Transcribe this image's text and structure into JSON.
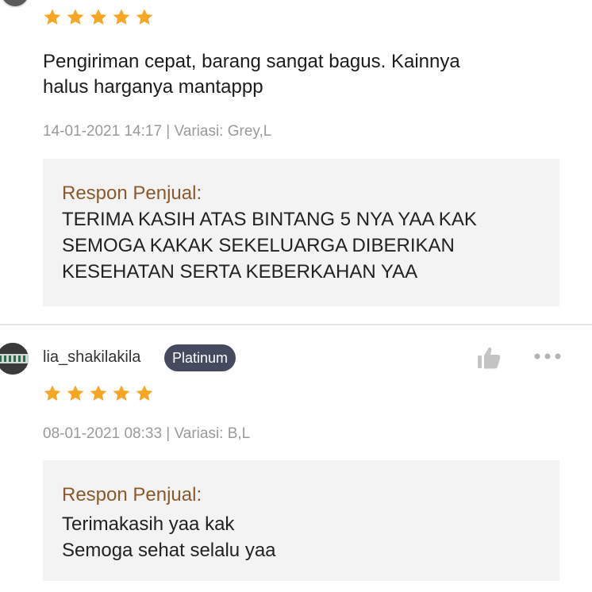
{
  "review1": {
    "rating": 5,
    "comment_line1": "Pengiriman cepat, barang sangat bagus. Kainnya",
    "comment_line2": "halus harganya mantappp",
    "meta": "14-01-2021 14:17 | Variasi: Grey,L",
    "reply": {
      "title": "Respon Penjual:",
      "lines": [
        "TERIMA KASIH ATAS BINTANG 5 NYA YAA KAK",
        "SEMOGA KAKAK SEKELUARGA DIBERIKAN",
        "KESEHATAN SERTA KEBERKAHAN YAA"
      ]
    }
  },
  "review2": {
    "username": "lia_shakilakila",
    "badge": "Platinum",
    "rating": 5,
    "meta": "08-01-2021 08:33 | Variasi: B,L",
    "reply": {
      "title": "Respon Penjual:",
      "lines": [
        "Terimakasih yaa kak",
        "Semoga sehat selalu yaa"
      ]
    }
  },
  "icons": {
    "star": "star-icon",
    "like": "thumbs-up-icon",
    "more": "more-dots-icon"
  },
  "colors": {
    "star": "#f6a623",
    "reply_title": "#8b5a2b",
    "badge_bg": "#454a5e",
    "meta_text": "#9a9a9a",
    "reply_bg": "#f3f3f3"
  }
}
